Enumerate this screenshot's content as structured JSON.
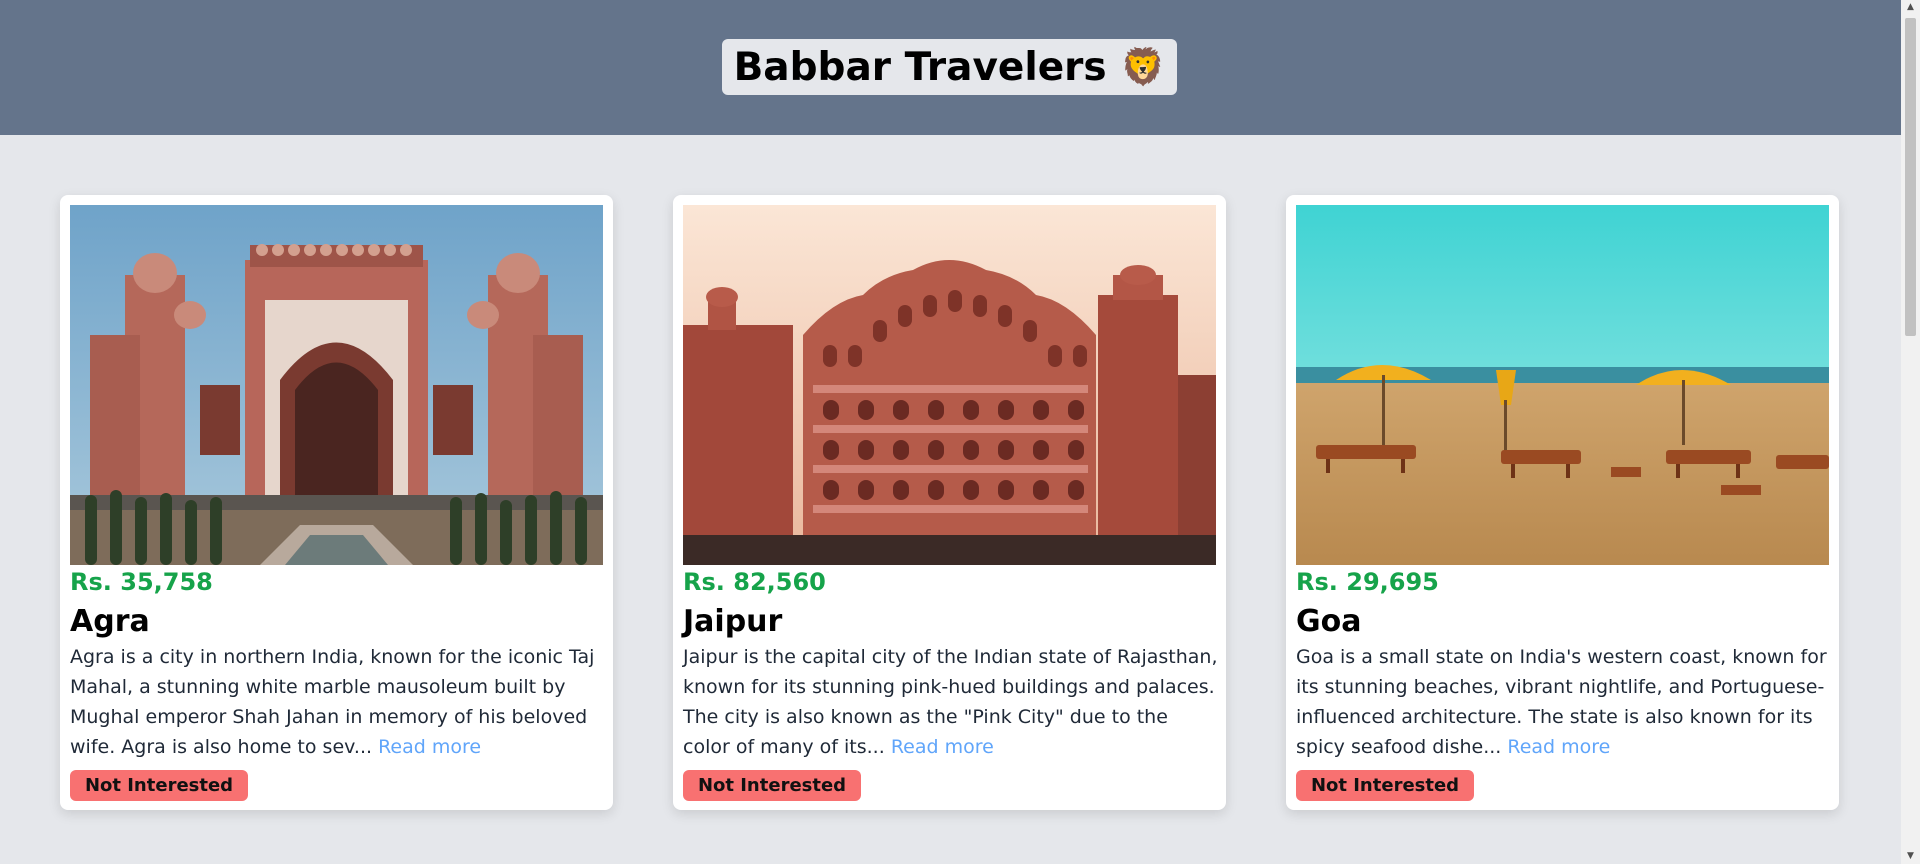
{
  "header": {
    "title": "Babbar Travelers",
    "emoji": "🦁"
  },
  "tours": [
    {
      "price": "Rs. 35,758",
      "name": "Agra",
      "description": "Agra is a city in northern India, known for the iconic Taj Mahal, a stunning white marble mausoleum built by Mughal emperor Shah Jahan in memory of his beloved wife. Agra is also home to sev...",
      "read_more": "Read more",
      "button": "Not Interested"
    },
    {
      "price": "Rs. 82,560",
      "name": "Jaipur",
      "description": "Jaipur is the capital city of the Indian state of Rajasthan, known for its stunning pink-hued buildings and palaces. The city is also known as the \"Pink City\" due to the color of many of its...",
      "read_more": "Read more",
      "button": "Not Interested"
    },
    {
      "price": "Rs. 29,695",
      "name": "Goa",
      "description": "Goa is a small state on India's western coast, known for its stunning beaches, vibrant nightlife, and Portuguese-influenced architecture. The state is also known for its spicy seafood dishe...",
      "read_more": "Read more",
      "button": "Not Interested"
    }
  ],
  "colors": {
    "header_bg": "#64748b",
    "page_bg": "#e5e7eb",
    "price": "#16a34a",
    "read_more": "#60a5fa",
    "button_bg": "#f87171"
  },
  "scrollbar": {
    "up_icon": "triangle-up",
    "down_icon": "triangle-down"
  }
}
